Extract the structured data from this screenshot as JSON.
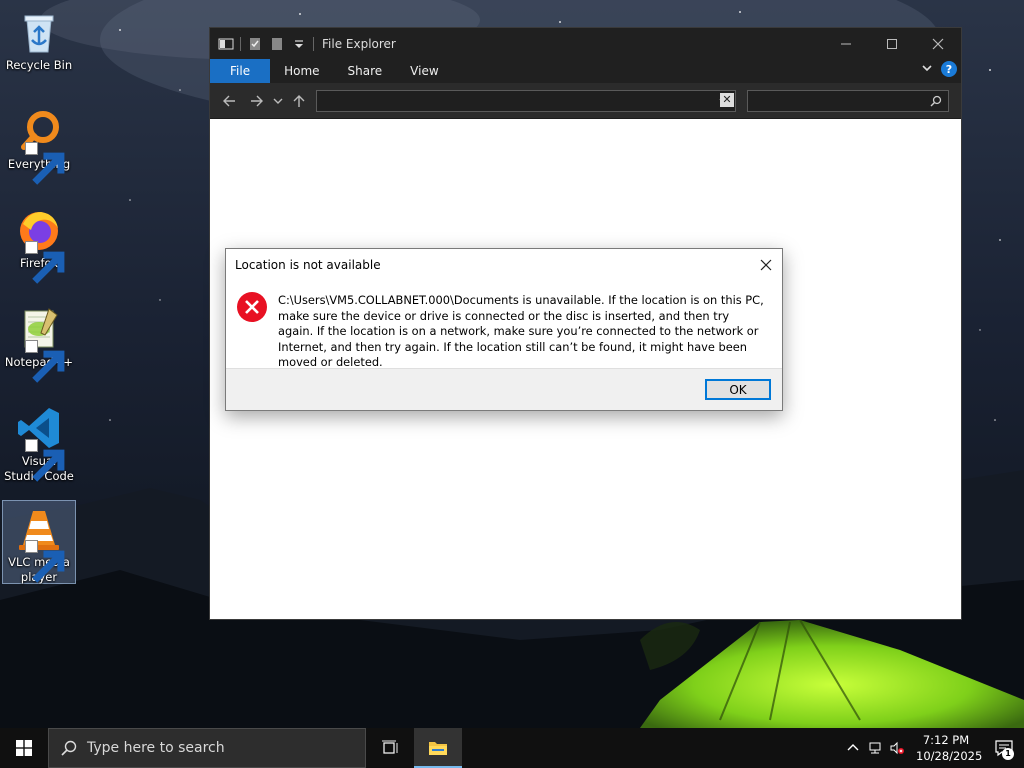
{
  "desktop": {
    "icons": [
      {
        "label": "Recycle Bin",
        "icon": "recycle-bin-icon"
      },
      {
        "label": "Everything",
        "icon": "everything-icon"
      },
      {
        "label": "Firefox",
        "icon": "firefox-icon"
      },
      {
        "label": "Notepad++",
        "icon": "notepad-plus-plus-icon"
      },
      {
        "label": "Visual Studio Code",
        "icon": "vscode-icon"
      },
      {
        "label": "VLC media player",
        "icon": "vlc-icon"
      }
    ]
  },
  "explorer": {
    "title": "File Explorer",
    "tabs": [
      "File",
      "Home",
      "Share",
      "View"
    ],
    "help_label": "?",
    "address_value": "",
    "search_placeholder": "",
    "accent": "#1a6fc4"
  },
  "dialog": {
    "title": "Location is not available",
    "message": "C:\\Users\\VM5.COLLABNET.000\\Documents is unavailable. If the location is on this PC, make sure the device or drive is connected or the disc is inserted, and then try again. If the location is on a network, make sure you’re connected to the network or Internet, and then try again. If the location still can’t be found, it might have been moved or deleted.",
    "ok_label": "OK",
    "error_color": "#e81123"
  },
  "taskbar": {
    "search_placeholder": "Type here to search",
    "time": "7:12 PM",
    "date": "10/28/2025",
    "notification_count": "1"
  }
}
